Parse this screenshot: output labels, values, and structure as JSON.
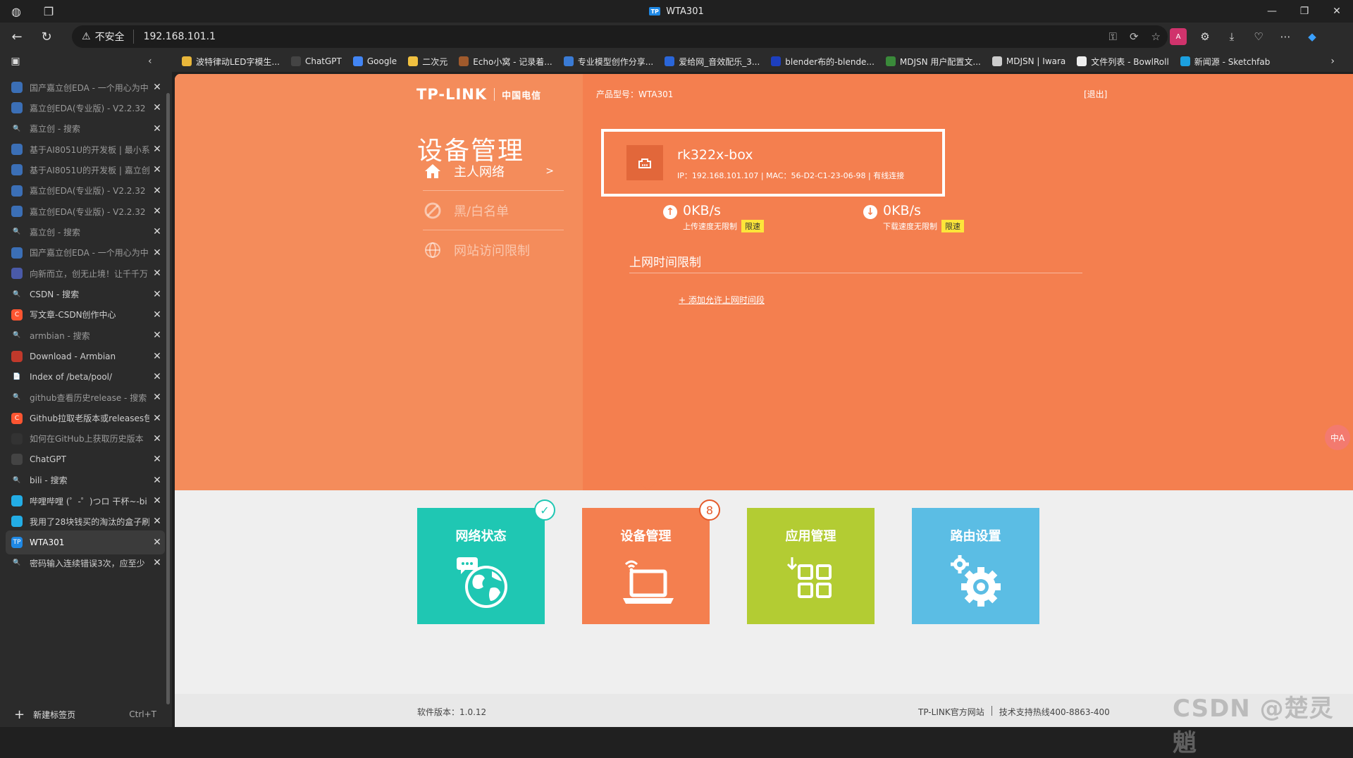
{
  "window": {
    "title": "WTA301",
    "favicon_text": "TP"
  },
  "addressbar": {
    "security_label": "不安全",
    "url": "192.168.101.1"
  },
  "bookmarks": [
    {
      "label": "波特律动LED字模生...",
      "color": "#e8b63a"
    },
    {
      "label": "ChatGPT",
      "color": "#444444"
    },
    {
      "label": "Google",
      "color": "#4285f4"
    },
    {
      "label": "二次元",
      "color": "#f0c040"
    },
    {
      "label": "Echo小窝 - 记录着...",
      "color": "#a05a2c"
    },
    {
      "label": "专业模型创作分享...",
      "color": "#3a7bd5"
    },
    {
      "label": "爱给网_音效配乐_3...",
      "color": "#2a66d9"
    },
    {
      "label": "blender布的-blende...",
      "color": "#1d3fbf"
    },
    {
      "label": "MDJSN 用户配置文...",
      "color": "#3a8a3a"
    },
    {
      "label": "MDJSN | Iwara",
      "color": "#cccccc"
    },
    {
      "label": "文件列表 - BowlRoll",
      "color": "#eeeeee"
    },
    {
      "label": "新闻源 - Sketchfab",
      "color": "#1ca0e0"
    }
  ],
  "tabs": [
    {
      "label": "国产嘉立创EDA - 一个用心为中",
      "fav": "",
      "color": "#3b6fb6",
      "dim": true
    },
    {
      "label": "嘉立创EDA(专业版) - V2.2.32",
      "fav": "",
      "color": "#3b6fb6",
      "dim": true
    },
    {
      "label": "嘉立创 - 搜索",
      "fav": "🔍",
      "color": "transparent",
      "dim": true
    },
    {
      "label": "基于AI8051U的开发板 | 最小系",
      "fav": "",
      "color": "#3b6fb6",
      "dim": true
    },
    {
      "label": "基于AI8051U的开发板 | 嘉立创",
      "fav": "",
      "color": "#3b6fb6",
      "dim": true
    },
    {
      "label": "嘉立创EDA(专业版) - V2.2.32",
      "fav": "",
      "color": "#3b6fb6",
      "dim": true
    },
    {
      "label": "嘉立创EDA(专业版) - V2.2.32",
      "fav": "",
      "color": "#3b6fb6",
      "dim": true
    },
    {
      "label": "嘉立创 - 搜索",
      "fav": "🔍",
      "color": "transparent",
      "dim": true
    },
    {
      "label": "国产嘉立创EDA - 一个用心为中",
      "fav": "",
      "color": "#3b6fb6",
      "dim": true
    },
    {
      "label": "向新而立，创无止境！让千千万",
      "fav": "",
      "color": "#4a5aa8",
      "dim": true
    },
    {
      "label": "CSDN - 搜索",
      "fav": "🔍",
      "color": "transparent",
      "dim": false
    },
    {
      "label": "写文章-CSDN创作中心",
      "fav": "C",
      "color": "#fc5531",
      "dim": false
    },
    {
      "label": "armbian - 搜索",
      "fav": "🔍",
      "color": "transparent",
      "dim": true
    },
    {
      "label": "Download - Armbian",
      "fav": "",
      "color": "#c0392b",
      "dim": false
    },
    {
      "label": "Index of /beta/pool/",
      "fav": "📄",
      "color": "transparent",
      "dim": false
    },
    {
      "label": "github查看历史release - 搜索",
      "fav": "🔍",
      "color": "transparent",
      "dim": true
    },
    {
      "label": "Github拉取老版本或releases包",
      "fav": "C",
      "color": "#fc5531",
      "dim": false
    },
    {
      "label": "如何在GitHub上获取历史版本",
      "fav": "",
      "color": "#333333",
      "dim": true
    },
    {
      "label": "ChatGPT",
      "fav": "",
      "color": "#444444",
      "dim": false
    },
    {
      "label": "bili - 搜索",
      "fav": "🔍",
      "color": "transparent",
      "dim": false
    },
    {
      "label": "哔哩哔哩 (゜-゜)つロ 干杯~-bi",
      "fav": "",
      "color": "#23ade5",
      "dim": false
    },
    {
      "label": "我用了28块钱买的淘汰的盒子刷",
      "fav": "",
      "color": "#23ade5",
      "dim": false
    },
    {
      "label": "WTA301",
      "fav": "TP",
      "color": "#1e88e5",
      "dim": false,
      "active": true
    },
    {
      "label": "密码输入连续错误3次，应至少",
      "fav": "🔍",
      "color": "transparent",
      "dim": false
    }
  ],
  "newtab": {
    "label": "新建标签页",
    "shortcut": "Ctrl+T"
  },
  "router": {
    "logo": "TP-LINK",
    "logo_partner": "中国电信",
    "product_label": "产品型号：WTA301",
    "logout": "[退出]",
    "page_title": "设备管理",
    "menu": [
      {
        "label": "主人网络",
        "icon": "home-icon",
        "active": true,
        "arrow": ">"
      },
      {
        "label": "黑/白名单",
        "icon": "block-icon",
        "active": false
      },
      {
        "label": "网站访问限制",
        "icon": "globe-icon",
        "active": false
      }
    ],
    "device": {
      "name": "rk322x-box",
      "info": "IP：192.168.101.107 | MAC：56-D2-C1-23-06-98 | 有线连接"
    },
    "upload": {
      "value": "0KB/s",
      "label": "上传速度无限制",
      "button": "限速"
    },
    "download": {
      "value": "0KB/s",
      "label": "下载速度无限制",
      "button": "限速"
    },
    "section_title": "上网时间限制",
    "add_link": "+ 添加允许上网时间段",
    "tiles": [
      {
        "label": "网络状态",
        "color": "#1fc7b3",
        "badge": "✓",
        "badge_color": "#1fc7b3"
      },
      {
        "label": "设备管理",
        "color": "#f47f4f",
        "badge": "8",
        "badge_color": "#e55a2b"
      },
      {
        "label": "应用管理",
        "color": "#b3cc33",
        "badge": "",
        "badge_color": ""
      },
      {
        "label": "路由设置",
        "color": "#5bbde4",
        "badge": "",
        "badge_color": ""
      }
    ],
    "footer": {
      "version": "软件版本：1.0.12",
      "official_site": "TP-LINK官方网站",
      "hotline": "技术支持热线400-8863-400"
    }
  },
  "translate_fab": "中A",
  "watermark": "CSDN @楚灵魈"
}
